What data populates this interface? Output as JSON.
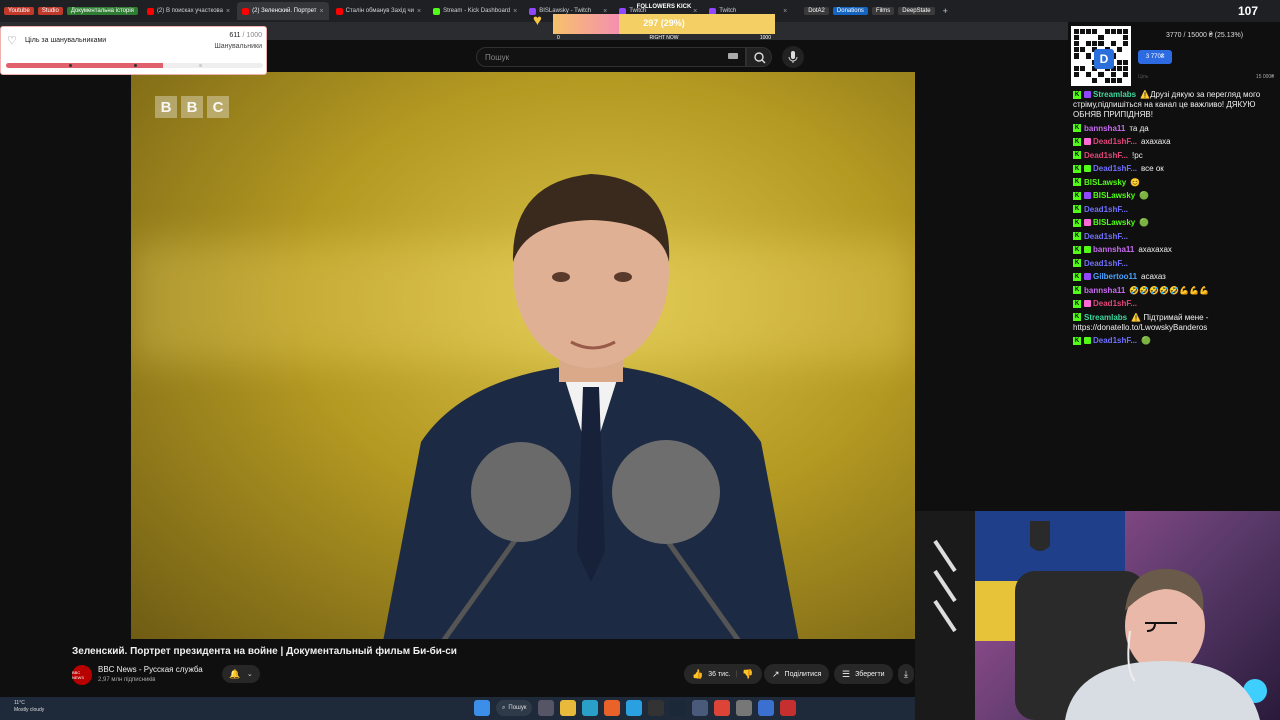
{
  "bookmarks": [
    {
      "label": "Youtube",
      "color": "#c0392b"
    },
    {
      "label": "Studio",
      "color": "#c0392b"
    },
    {
      "label": "Документальна історія",
      "color": "#2e7d32"
    }
  ],
  "tabs": [
    {
      "label": "(2) В поисках участкова",
      "color": "#ff0000",
      "active": false
    },
    {
      "label": "(2) Зеленский. Портрет",
      "color": "#ff0000",
      "active": true
    },
    {
      "label": "Сталін обманув Захід чи",
      "color": "#ff0000",
      "active": false
    },
    {
      "label": "Stream - Kick Dashboard",
      "color": "#53fc18",
      "active": false
    },
    {
      "label": "BISLawsky - Twitch",
      "color": "#9146ff",
      "active": false
    },
    {
      "label": "Twitch",
      "color": "#9146ff",
      "active": false
    },
    {
      "label": "Twitch",
      "color": "#9146ff",
      "active": false
    }
  ],
  "right_bookmarks": [
    {
      "label": "DotA2",
      "color": "#3a3a3a"
    },
    {
      "label": "Donations",
      "color": "#1565c0"
    },
    {
      "label": "Films",
      "color": "#3a3a3a"
    },
    {
      "label": "DeepState",
      "color": "#3a3a3a"
    }
  ],
  "search": {
    "placeholder": "Пошук"
  },
  "video": {
    "logo_letters": [
      "B",
      "B",
      "C"
    ],
    "title": "Зеленский. Портрет президента на войне | Документальный фильм Би-би-си",
    "channel_avatar": "BBC NEWS",
    "channel_name": "BBC News - Русская служба",
    "channel_subs": "2,97 млн підписників",
    "likes": "36 тис.",
    "share": "Поділитися",
    "save": "Зберегти"
  },
  "goal_widget": {
    "label": "Ціль за шанувальниками",
    "current": "611",
    "total": "/ 1000",
    "unit": "Шанувальники",
    "fill_fraction": 0.611
  },
  "followers_kick": {
    "title": "FOLLOWERS KICK",
    "value": "297 (29%)",
    "min": "0",
    "center": "RIGHT NOW",
    "max": "1000",
    "fraction": 0.297
  },
  "donation_widget": {
    "progress": "3770 / 15000 ₴ (25.13%)",
    "button": "3 770₴",
    "low_label": "Ціль",
    "high_label": "15 000₴"
  },
  "viewer_count": "107",
  "chat": [
    {
      "user": "Streamlabs",
      "ucolor": "#3ed8a0",
      "text": "⚠️Друзі дякую за перегляд мого стріму,підпишіться на канал це важливо! ДЯКУЮ ОБНЯВ ПРИПІДНЯВ!"
    },
    {
      "user": "bannsha11",
      "ucolor": "#c76cf0",
      "text": "та да"
    },
    {
      "user": "Dead1shF...",
      "ucolor": "#e0457b",
      "text": "ахахаха"
    },
    {
      "user": "Dead1shF...",
      "ucolor": "#e0457b",
      "text": "!pc"
    },
    {
      "user": "Dead1shF...",
      "ucolor": "#7070ff",
      "text": "все ок"
    },
    {
      "user": "BISLawsky",
      "ucolor": "#53fc18",
      "text": "😊"
    },
    {
      "user": "BISLawsky",
      "ucolor": "#53fc18",
      "text": "🟢"
    },
    {
      "user": "Dead1shF...",
      "ucolor": "#7070ff",
      "text": ""
    },
    {
      "user": "BISLawsky",
      "ucolor": "#53fc18",
      "text": "🟢"
    },
    {
      "user": "Dead1shF...",
      "ucolor": "#7070ff",
      "text": ""
    },
    {
      "user": "bannsha11",
      "ucolor": "#c76cf0",
      "text": "ахахахах"
    },
    {
      "user": "Dead1shF...",
      "ucolor": "#7070ff",
      "text": ""
    },
    {
      "user": "Gilbertoo11",
      "ucolor": "#4aa3ff",
      "text": "асахаз"
    },
    {
      "user": "bannsha11",
      "ucolor": "#c76cf0",
      "text": "🤣🤣🤣🤣🤣💪💪💪"
    },
    {
      "user": "Dead1shF...",
      "ucolor": "#e0457b",
      "text": ""
    },
    {
      "user": "Streamlabs",
      "ucolor": "#3ed8a0",
      "text": "⚠️ Підтримай мене - https://donatello.to/LwowskyBanderos"
    },
    {
      "user": "Dead1shF...",
      "ucolor": "#7070ff",
      "text": "🟢"
    }
  ],
  "taskbar": {
    "weather_temp": "11°C",
    "weather_desc": "Mostly cloudy",
    "search_label": "Пошук"
  },
  "colors": {
    "youtube_bg": "#0f0f0f",
    "kick_green": "#53fc18",
    "goal_fill": "#e0606c",
    "fk_fill": "#f58fb0"
  }
}
